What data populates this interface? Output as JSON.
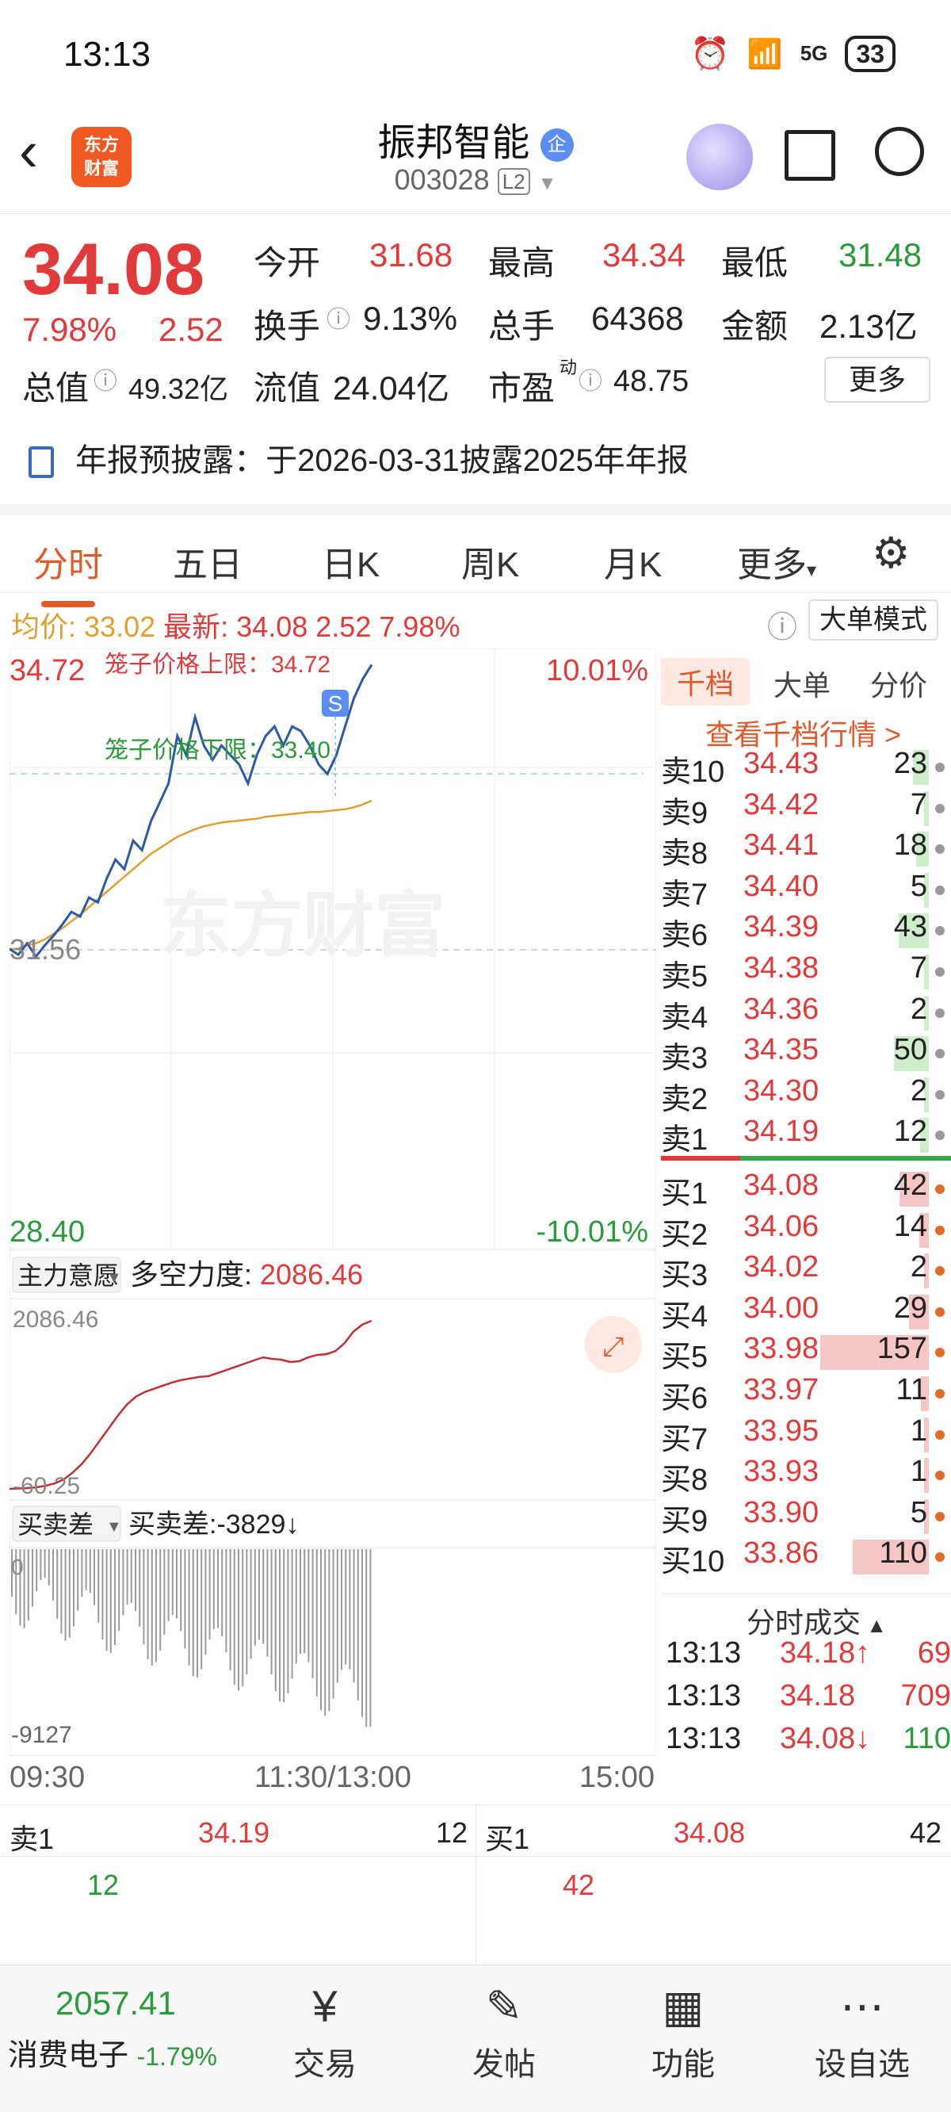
{
  "status": {
    "time": "13:13",
    "net": "5G",
    "battery": "33"
  },
  "header": {
    "logo_line1": "东方",
    "logo_line2": "财富",
    "stock_name": "振邦智能",
    "badge": "企",
    "code": "003028",
    "level": "L2"
  },
  "quote": {
    "price": "34.08",
    "pct": "7.98%",
    "change": "2.52",
    "open_label": "今开",
    "open": "31.68",
    "high_label": "最高",
    "high": "34.34",
    "low_label": "最低",
    "low": "31.48",
    "turnover_label": "换手",
    "turnover": "9.13%",
    "volume_label": "总手",
    "volume": "64368",
    "amount_label": "金额",
    "amount": "2.13亿",
    "mktcap_label": "总值",
    "mktcap": "49.32亿",
    "float_label": "流值",
    "float": "24.04亿",
    "pe_label": "市盈",
    "pe_sup": "动",
    "pe": "48.75",
    "more": "更多"
  },
  "notice": "年报预披露：于2026-03-31披露2025年年报",
  "tabs": [
    "分时",
    "五日",
    "日K",
    "周K",
    "月K",
    "更多"
  ],
  "summary": {
    "avg_label": "均价:",
    "avg": "33.02",
    "latest_label": "最新:",
    "latest": "34.08",
    "change": "2.52",
    "pct": "7.98%",
    "mode": "大单模式"
  },
  "chart_data": {
    "type": "line",
    "price_max": "34.72",
    "pct_max": "10.01%",
    "price_min": "28.40",
    "pct_min": "-10.01%",
    "prev_close": "31.56",
    "cage_upper": "笼子价格上限：34.72",
    "cage_lower": "笼子价格下限：33.40",
    "marker": "S",
    "watermark": "东方财富",
    "ylim": [
      28.4,
      34.72
    ],
    "price": [
      31.56,
      31.5,
      31.62,
      31.48,
      31.6,
      31.7,
      31.82,
      31.95,
      31.9,
      32.1,
      32.05,
      32.3,
      32.5,
      32.4,
      32.7,
      32.6,
      32.9,
      33.1,
      33.3,
      33.8,
      33.6,
      34.0,
      33.7,
      33.55,
      33.7,
      33.6,
      33.5,
      33.3,
      33.6,
      33.8,
      33.9,
      33.7,
      33.9,
      33.85,
      33.7,
      33.5,
      33.4,
      33.6,
      33.9,
      34.2,
      34.4,
      34.55
    ],
    "avg": [
      31.56,
      31.56,
      31.6,
      31.62,
      31.66,
      31.72,
      31.78,
      31.85,
      31.92,
      32.0,
      32.08,
      32.16,
      32.24,
      32.32,
      32.4,
      32.48,
      32.56,
      32.62,
      32.68,
      32.74,
      32.78,
      32.82,
      32.85,
      32.87,
      32.89,
      32.9,
      32.91,
      32.92,
      32.93,
      32.95,
      32.96,
      32.97,
      32.98,
      32.99,
      33.0,
      33.0,
      33.01,
      33.02,
      33.03,
      33.05,
      33.08,
      33.12
    ],
    "indicator_label": "主力意愿",
    "indicator_name": "多空力度:",
    "indicator_value": "2086.46",
    "indicator_max": "2086.46",
    "indicator_min": "-60.25",
    "indicator": [
      -60,
      -55,
      -50,
      -40,
      -20,
      10,
      60,
      150,
      260,
      400,
      560,
      720,
      880,
      1020,
      1120,
      1180,
      1220,
      1260,
      1300,
      1330,
      1350,
      1370,
      1380,
      1420,
      1460,
      1500,
      1540,
      1580,
      1620,
      1600,
      1590,
      1560,
      1570,
      1620,
      1650,
      1660,
      1700,
      1800,
      1950,
      2040,
      2086
    ],
    "diff_label": "买卖差",
    "diff_text": "买卖差:-3829↓",
    "diff_max": "0",
    "diff_min": "-9127",
    "time_labels": [
      "09:30",
      "11:30/13:00",
      "15:00"
    ]
  },
  "book": {
    "tabs": [
      "千档",
      "大单",
      "分价"
    ],
    "link": "查看千档行情 >",
    "asks": [
      {
        "label": "卖10",
        "price": "34.43",
        "vol": "23"
      },
      {
        "label": "卖9",
        "price": "34.42",
        "vol": "7"
      },
      {
        "label": "卖8",
        "price": "34.41",
        "vol": "18"
      },
      {
        "label": "卖7",
        "price": "34.40",
        "vol": "5"
      },
      {
        "label": "卖6",
        "price": "34.39",
        "vol": "43"
      },
      {
        "label": "卖5",
        "price": "34.38",
        "vol": "7"
      },
      {
        "label": "卖4",
        "price": "34.36",
        "vol": "2"
      },
      {
        "label": "卖3",
        "price": "34.35",
        "vol": "50"
      },
      {
        "label": "卖2",
        "price": "34.30",
        "vol": "2"
      },
      {
        "label": "卖1",
        "price": "34.19",
        "vol": "12"
      }
    ],
    "bids": [
      {
        "label": "买1",
        "price": "34.08",
        "vol": "42"
      },
      {
        "label": "买2",
        "price": "34.06",
        "vol": "14"
      },
      {
        "label": "买3",
        "price": "34.02",
        "vol": "2"
      },
      {
        "label": "买4",
        "price": "34.00",
        "vol": "29"
      },
      {
        "label": "买5",
        "price": "33.98",
        "vol": "157"
      },
      {
        "label": "买6",
        "price": "33.97",
        "vol": "11"
      },
      {
        "label": "买7",
        "price": "33.95",
        "vol": "1"
      },
      {
        "label": "买8",
        "price": "33.93",
        "vol": "1"
      },
      {
        "label": "买9",
        "price": "33.90",
        "vol": "5"
      },
      {
        "label": "买10",
        "price": "33.86",
        "vol": "110"
      }
    ],
    "trades_title": "分时成交",
    "trades": [
      {
        "time": "13:13",
        "price": "34.18↑",
        "vol": "69"
      },
      {
        "time": "13:13",
        "price": "34.18",
        "vol": "709"
      },
      {
        "time": "13:13",
        "price": "34.08↓",
        "vol": "110"
      }
    ]
  },
  "level1": {
    "ask_label": "卖1",
    "ask_price": "34.19",
    "ask_vol": "12",
    "ask_sub": "12",
    "bid_label": "买1",
    "bid_price": "34.08",
    "bid_vol": "42",
    "bid_sub": "42"
  },
  "nav": {
    "index_value": "2057.41",
    "index_name": "消费电子",
    "index_pct": "-1.79%",
    "items": [
      "交易",
      "发帖",
      "功能",
      "设自选"
    ]
  },
  "colors": {
    "up": "#e03a3a",
    "down": "#2a9a3a",
    "accent": "#e05a2a",
    "line": "#2a5aa8",
    "avg": "#e0a030"
  }
}
